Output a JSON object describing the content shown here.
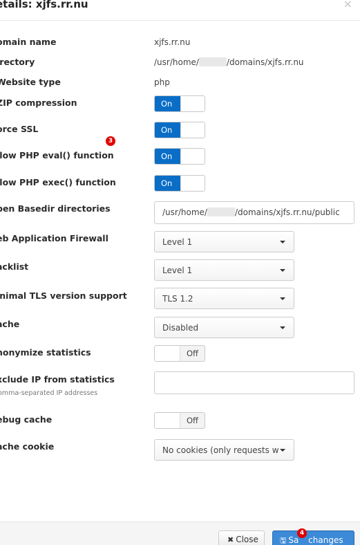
{
  "modal": {
    "title": "etails: xjfs.rr.nu",
    "close_glyph": "×"
  },
  "fields": {
    "domain_name": {
      "label": "omain name",
      "value": "xjfs.rr.nu"
    },
    "directory": {
      "label": "irectory",
      "value_prefix": "/usr/home/",
      "value_suffix": "/domains/xjfs.rr.nu"
    },
    "website_type": {
      "label": "Website type",
      "value": "php"
    },
    "gzip": {
      "label": "ZIP compression",
      "state": "On"
    },
    "force_ssl": {
      "label": "orce SSL",
      "state": "On"
    },
    "php_eval": {
      "label": "llow PHP eval() function",
      "state": "On"
    },
    "php_exec": {
      "label": "llow PHP exec() function",
      "state": "On"
    },
    "open_basedir": {
      "label": "pen Basedir directories",
      "value_prefix": "/usr/home/",
      "value_suffix": "/domains/xjfs.rr.nu/public"
    },
    "waf": {
      "label": "eb Application Firewall",
      "selected": "Level 1"
    },
    "blacklist": {
      "label": "acklist",
      "selected": "Level 1"
    },
    "min_tls": {
      "label": "inimal TLS version support",
      "selected": "TLS 1.2"
    },
    "cache": {
      "label": "ache",
      "selected": "Disabled"
    },
    "anonymize": {
      "label": "nonymize statistics",
      "state": "Off"
    },
    "exclude_ip": {
      "label": "xclude IP from statistics",
      "help": "omma-separated IP addresses",
      "value": ""
    },
    "debug_cache": {
      "label": "ebug cache",
      "state": "Off"
    },
    "cache_cookie": {
      "label": "ache cookie",
      "selected": "No cookies (only requests w"
    }
  },
  "badges": {
    "badge_3": "3",
    "badge_4": "4"
  },
  "footer": {
    "close_label": "Close",
    "close_icon": "✖",
    "save_label_a": "Sa",
    "save_label_b": " changes",
    "save_icon": "🖫"
  },
  "colors": {
    "accent": "#0a6ec7",
    "save_button": "#3c8ad8",
    "badge": "#e00000"
  },
  "icons": {
    "close": "close-icon",
    "caret": "caret-down-icon",
    "save": "floppy-disk-icon"
  }
}
